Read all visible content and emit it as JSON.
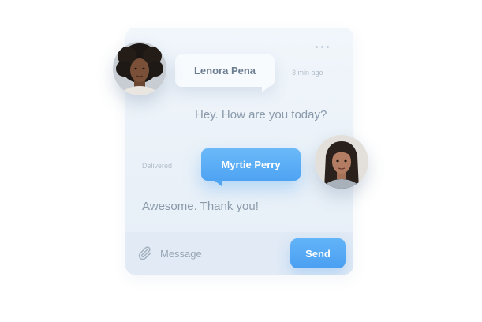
{
  "menu": {
    "icon": "more-dots-icon"
  },
  "conversation": {
    "incoming": {
      "sender_name": "Lenora Pena",
      "time": "3 min ago",
      "text": "Hey. How are you today?",
      "avatar": "avatar-woman-curly-hair"
    },
    "outgoing": {
      "sender_name": "Myrtie Perry",
      "status": "Delivered",
      "text": "Awesome. Thank you!",
      "avatar": "avatar-woman-dark-hair"
    }
  },
  "composer": {
    "attach_icon": "paperclip-icon",
    "placeholder": "Message",
    "send_label": "Send"
  },
  "colors": {
    "accent": "#4ea3f2",
    "card_background": "#eef4fa",
    "input_bar_background": "#e1eaf5",
    "text_muted": "#8a9aab"
  }
}
